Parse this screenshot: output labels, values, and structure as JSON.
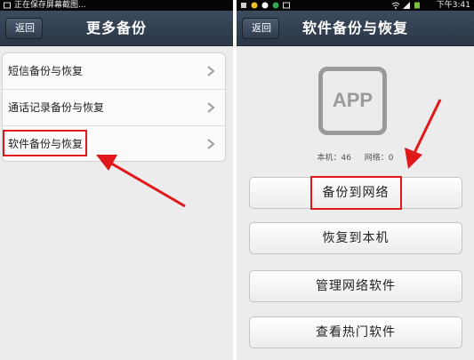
{
  "left_screen": {
    "status_text": "正在保存屏幕截图...",
    "back_label": "返回",
    "title": "更多备份",
    "menu_items": [
      {
        "label": "短信备份与恢复"
      },
      {
        "label": "通话记录备份与恢复"
      },
      {
        "label": "软件备份与恢复"
      }
    ]
  },
  "right_screen": {
    "status_time": "下午3:41",
    "back_label": "返回",
    "title": "软件备份与恢复",
    "app_icon_text": "APP",
    "local_count_label": "本机：46",
    "network_count_label": "网络：0",
    "buttons": [
      {
        "label": "备份到网络"
      },
      {
        "label": "恢复到本机"
      },
      {
        "label": "管理网络软件"
      },
      {
        "label": "查看热门软件"
      }
    ]
  },
  "annotation_color": "#e0181b",
  "icons": [
    "back-arrow-icon",
    "chevron-right-icon",
    "app-placeholder-icon",
    "annotation-arrow-icon"
  ]
}
